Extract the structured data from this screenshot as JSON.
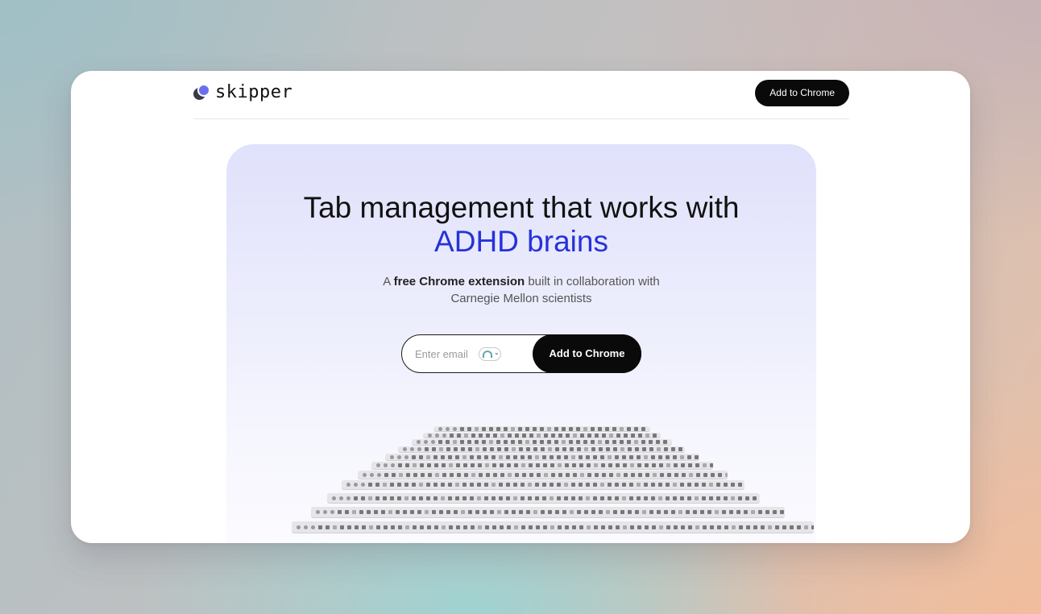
{
  "nav": {
    "logo_text": "skipper",
    "cta_label": "Add to Chrome"
  },
  "hero": {
    "headline_line1": "Tab management that works with",
    "headline_accent": "ADHD brains",
    "subtitle_prefix": "A ",
    "subtitle_bold": "free Chrome extension",
    "subtitle_rest": " built in collaboration with",
    "subtitle_line2": "Carnegie Mellon scientists",
    "email_placeholder": "Enter email",
    "signup_button_label": "Add to Chrome"
  },
  "colors": {
    "accent": "#2632d8",
    "button_bg": "#0a0a0a",
    "hero_bg_top": "#e0e1fb"
  },
  "icons": [
    "skipper-logo-icon",
    "password-manager-icon",
    "chevron-down-icon"
  ]
}
